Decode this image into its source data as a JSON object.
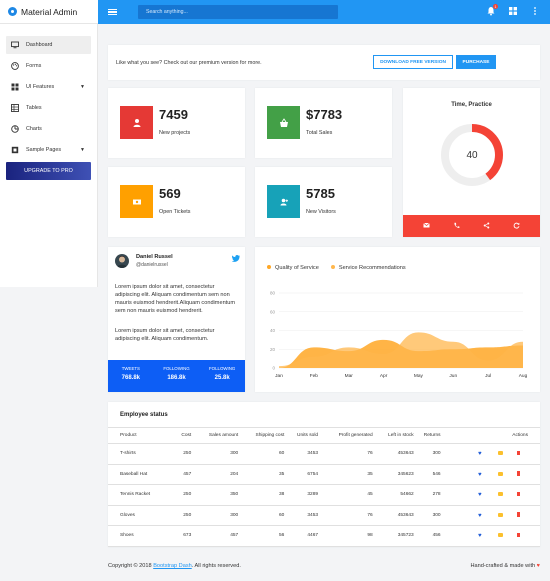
{
  "app": {
    "title": "Material Admin"
  },
  "search": {
    "placeholder": "Search anything..."
  },
  "topbar": {
    "notification_count": "1"
  },
  "sidebar": {
    "items": [
      {
        "label": "Dashboard",
        "icon": "monitor-icon",
        "active": true
      },
      {
        "label": "Forms",
        "icon": "palette-icon"
      },
      {
        "label": "UI Features",
        "icon": "grid-icon",
        "caret": true
      },
      {
        "label": "Tables",
        "icon": "table-icon"
      },
      {
        "label": "Charts",
        "icon": "chart-pie-icon"
      },
      {
        "label": "Sample Pages",
        "icon": "file-icon",
        "caret": true
      }
    ],
    "upgrade_label": "UPGRADE TO PRO"
  },
  "banner": {
    "text": "Like what you see? Check out our premium version for more.",
    "download_label": "DOWNLOAD FREE VERSION",
    "purchase_label": "PURCHASE"
  },
  "stats": [
    {
      "value": "7459",
      "label": "New projects",
      "color": "#e53935",
      "icon": "user-icon"
    },
    {
      "value": "$7783",
      "label": "Total Sales",
      "color": "#43a047",
      "icon": "basket-icon"
    },
    {
      "value": "569",
      "label": "Open Tickets",
      "color": "#ffa000",
      "icon": "ticket-icon"
    },
    {
      "value": "5785",
      "label": "New Visitors",
      "color": "#17a2b8",
      "icon": "user-plus-icon"
    }
  ],
  "time_practice": {
    "title": "Time, Practice",
    "value": "40",
    "progress": 0.4,
    "color": "#f44336"
  },
  "profile": {
    "name": "Daniel Russel",
    "handle": "@danielrussel",
    "para1": "Lorem ipsum dolor sit amet, consectetur adipiscing elit. Aliquam condimentum sem non mauris euismod hendrerit.Aliquam condimentum sem non mauris euismod hendrerit.",
    "para2": "Lorem ipsum dolor sit amet, consectetur adipiscing elit. Aliquam condimentum.",
    "stats": [
      {
        "label": "TWEETS",
        "value": "768.8k"
      },
      {
        "label": "FOLLOWING",
        "value": "186.8k"
      },
      {
        "label": "FOLLOWING",
        "value": "25.8k"
      }
    ]
  },
  "chart_data": {
    "type": "area",
    "categories": [
      "Jan",
      "Feb",
      "Mar",
      "Apr",
      "May",
      "Jun",
      "Jul",
      "Aug"
    ],
    "series": [
      {
        "name": "Quality of Service",
        "color": "#ffa726",
        "values": [
          0,
          22,
          18,
          30,
          18,
          20,
          22,
          24
        ]
      },
      {
        "name": "Service Recommendations",
        "color": "#ffb74d",
        "values": [
          2,
          12,
          22,
          15,
          38,
          28,
          8,
          28
        ]
      }
    ],
    "yticks": [
      0,
      20,
      40,
      60,
      80
    ],
    "ylim": [
      0,
      80
    ]
  },
  "employees": {
    "title": "Employee status",
    "columns": [
      "Product",
      "Cost",
      "Sales amount",
      "Shipping cost",
      "Units sold",
      "Profit generated",
      "Left in stock",
      "Returns",
      "",
      "Actions"
    ],
    "rows": [
      [
        "T-shirts",
        "250",
        "300",
        "60",
        "3453",
        "76",
        "453643",
        "300"
      ],
      [
        "Baseball Hat",
        "457",
        "204",
        "35",
        "6754",
        "35",
        "345623",
        "546"
      ],
      [
        "Tennis Racket",
        "250",
        "350",
        "38",
        "3289",
        "45",
        "54662",
        "278"
      ],
      [
        "Gloves",
        "250",
        "300",
        "60",
        "3453",
        "76",
        "453643",
        "300"
      ],
      [
        "Shoes",
        "673",
        "457",
        "56",
        "4467",
        "98",
        "345723",
        "456"
      ]
    ]
  },
  "footer": {
    "prefix": "Copyright © 2018",
    "link": "Bootstrap Dash",
    "suffix": ". All rights reserved.",
    "right": "Hand-crafted & made with"
  }
}
